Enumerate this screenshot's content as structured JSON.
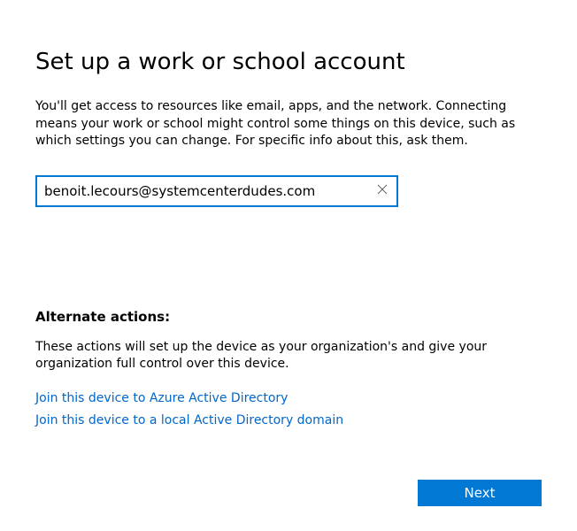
{
  "title": "Set up a work or school account",
  "description": "You'll get access to resources like email, apps, and the network. Connecting means your work or school might control some things on this device, such as which settings you can change. For specific info about this, ask them.",
  "email": {
    "value": "benoit.lecours@systemcenterdudes.com",
    "placeholder": ""
  },
  "alternate": {
    "heading": "Alternate actions:",
    "description": "These actions will set up the device as your organization's and give your organization full control over this device.",
    "links": {
      "azure": "Join this device to Azure Active Directory",
      "local": "Join this device to a local Active Directory domain"
    }
  },
  "buttons": {
    "next": "Next"
  }
}
